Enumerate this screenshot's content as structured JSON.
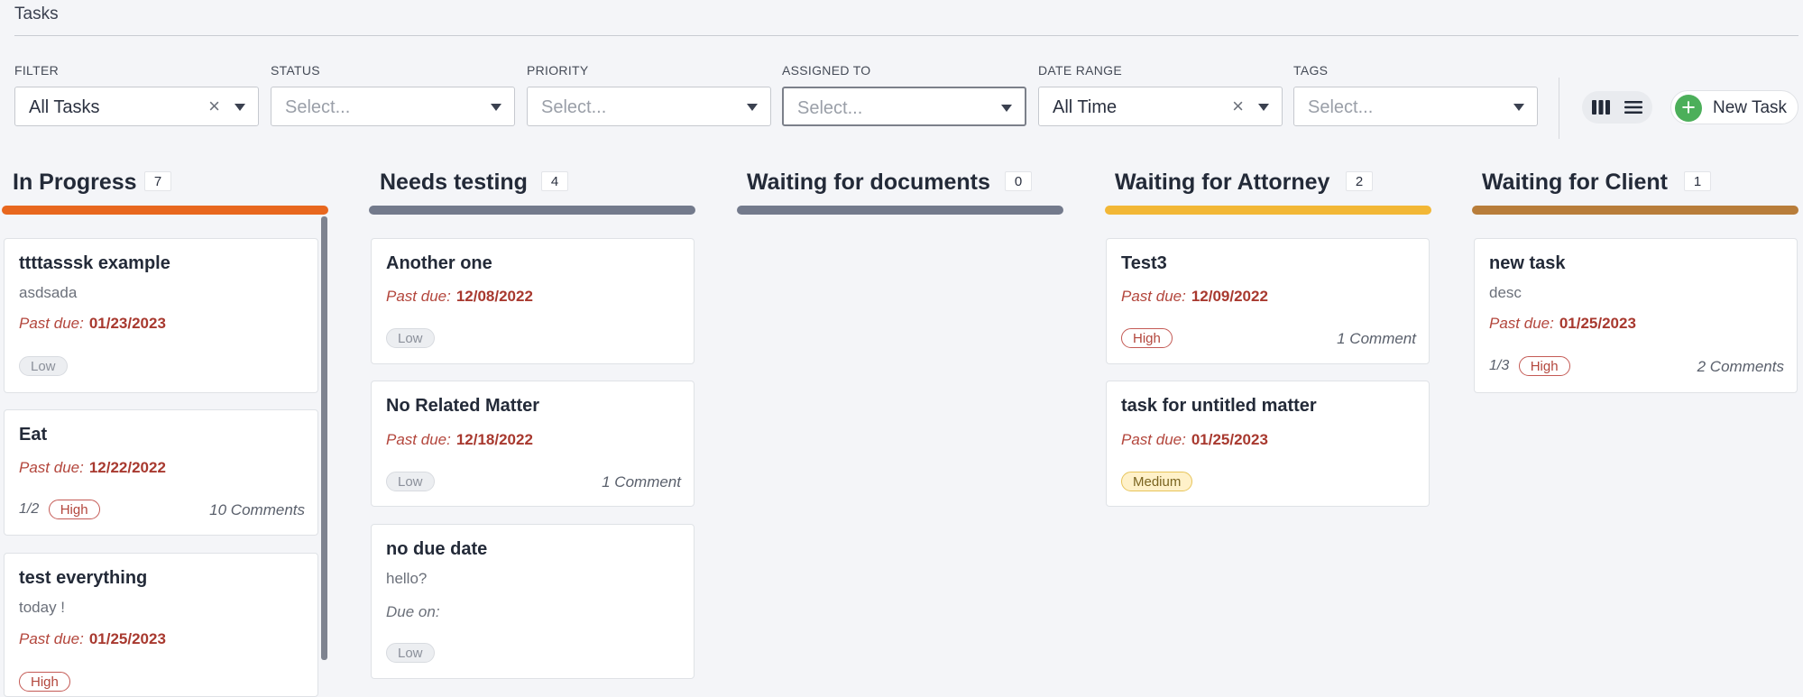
{
  "breadcrumb": "Tasks",
  "filters": [
    {
      "label": "FILTER",
      "value": "All Tasks",
      "placeholder": false,
      "clearable": true
    },
    {
      "label": "STATUS",
      "value": "Select...",
      "placeholder": true,
      "clearable": false
    },
    {
      "label": "PRIORITY",
      "value": "Select...",
      "placeholder": true,
      "clearable": false
    },
    {
      "label": "ASSIGNED TO",
      "value": "Select...",
      "placeholder": true,
      "clearable": false
    },
    {
      "label": "DATE RANGE",
      "value": "All Time",
      "placeholder": false,
      "clearable": true
    },
    {
      "label": "TAGS",
      "value": "Select...",
      "placeholder": true,
      "clearable": false
    }
  ],
  "toolbar": {
    "new_task_label": "New Task",
    "board_view_icon": "columns-icon",
    "list_view_icon": "list-icon"
  },
  "colors": {
    "in_progress": "#e8671e",
    "needs_testing": "#737a8c",
    "waiting_documents": "#737a8c",
    "waiting_attorney": "#f2b736",
    "waiting_client": "#b87d3a",
    "new_task_button": "#4caf5a"
  },
  "past_due_label": "Past due:",
  "due_on_label": "Due on:",
  "columns": [
    {
      "title": "In Progress",
      "count": "7",
      "cards": [
        {
          "title": "ttttasssk example",
          "desc": "asdsada",
          "due": "01/23/2023",
          "priority": "Low"
        },
        {
          "title": "Eat",
          "due": "12/22/2022",
          "subtasks": "1/2",
          "priority": "High",
          "comments": "10 Comments"
        },
        {
          "title": "test everything",
          "desc": "today !",
          "due": "01/25/2023",
          "priority": "High"
        }
      ]
    },
    {
      "title": "Needs testing",
      "count": "4",
      "cards": [
        {
          "title": "Another one",
          "due": "12/08/2022",
          "priority": "Low"
        },
        {
          "title": "No Related Matter",
          "due": "12/18/2022",
          "priority": "Low",
          "comments": "1 Comment"
        },
        {
          "title": "no due date",
          "desc": "hello?",
          "priority": "Low"
        }
      ]
    },
    {
      "title": "Waiting for documents",
      "count": "0",
      "cards": []
    },
    {
      "title": "Waiting for Attorney",
      "count": "2",
      "cards": [
        {
          "title": "Test3",
          "due": "12/09/2022",
          "priority": "High",
          "comments": "1 Comment"
        },
        {
          "title": "task for untitled matter",
          "due": "01/25/2023",
          "priority": "Medium"
        }
      ]
    },
    {
      "title": "Waiting for Client",
      "count": "1",
      "cards": [
        {
          "title": "new task",
          "desc": "desc",
          "due": "01/25/2023",
          "subtasks": "1/3",
          "priority": "High",
          "comments": "2 Comments"
        }
      ]
    }
  ]
}
